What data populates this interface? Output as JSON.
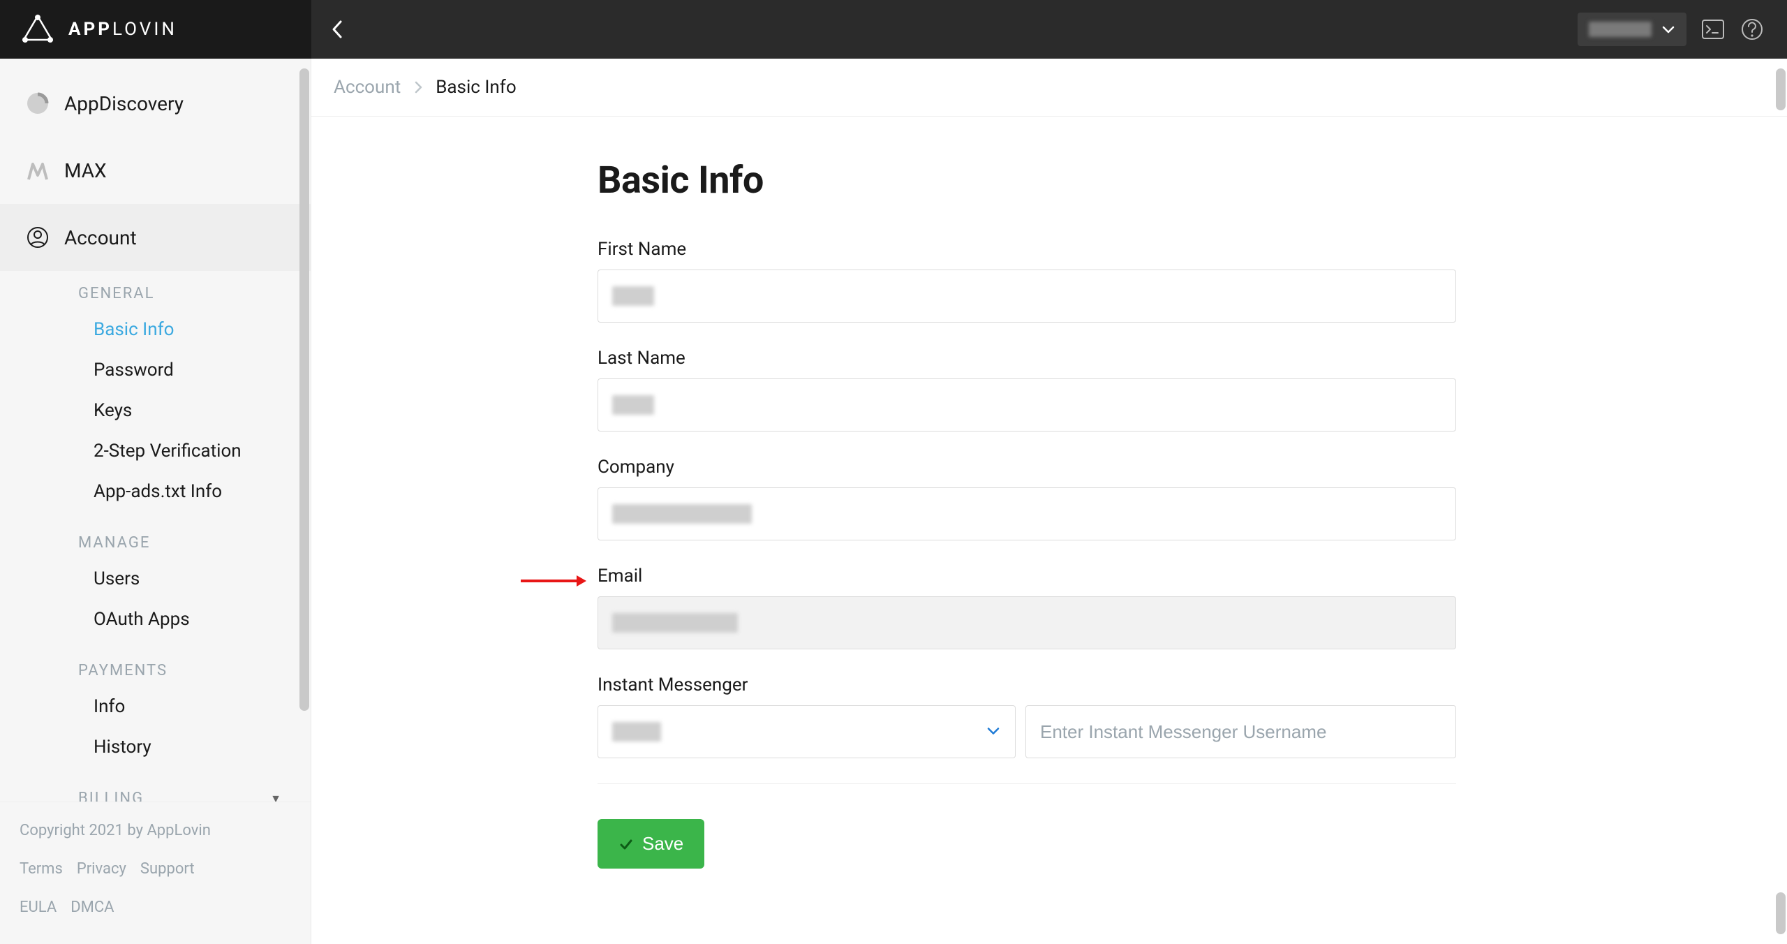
{
  "header": {
    "brand_bold": "APP",
    "brand_light": "LOVIN",
    "account_name": "••••••"
  },
  "sidebar": {
    "top_items": [
      {
        "key": "appdiscovery",
        "label": "AppDiscovery"
      },
      {
        "key": "max",
        "label": "MAX"
      },
      {
        "key": "account",
        "label": "Account"
      }
    ],
    "sections": {
      "general": {
        "label": "GENERAL",
        "items": [
          {
            "key": "basic-info",
            "label": "Basic Info",
            "selected": true
          },
          {
            "key": "password",
            "label": "Password"
          },
          {
            "key": "keys",
            "label": "Keys"
          },
          {
            "key": "two-step",
            "label": "2-Step Verification"
          },
          {
            "key": "app-ads",
            "label": "App-ads.txt Info"
          }
        ]
      },
      "manage": {
        "label": "MANAGE",
        "items": [
          {
            "key": "users",
            "label": "Users"
          },
          {
            "key": "oauth-apps",
            "label": "OAuth Apps"
          }
        ]
      },
      "payments": {
        "label": "PAYMENTS",
        "items": [
          {
            "key": "info",
            "label": "Info"
          },
          {
            "key": "history",
            "label": "History"
          }
        ]
      },
      "billing": {
        "label": "BILLING"
      }
    },
    "footer": {
      "copyright": "Copyright 2021 by AppLovin",
      "links1": [
        "Terms",
        "Privacy",
        "Support"
      ],
      "links2": [
        "EULA",
        "DMCA"
      ]
    }
  },
  "breadcrumb": {
    "root": "Account",
    "current": "Basic Info"
  },
  "page": {
    "title": "Basic Info",
    "fields": {
      "first_name": {
        "label": "First Name",
        "value": ""
      },
      "last_name": {
        "label": "Last Name",
        "value": ""
      },
      "company": {
        "label": "Company",
        "value": ""
      },
      "email": {
        "label": "Email",
        "value": "",
        "disabled": true
      },
      "im": {
        "label": "Instant Messenger",
        "selected": "",
        "username_placeholder": "Enter Instant Messenger Username",
        "username_value": ""
      }
    },
    "save_label": "Save"
  }
}
